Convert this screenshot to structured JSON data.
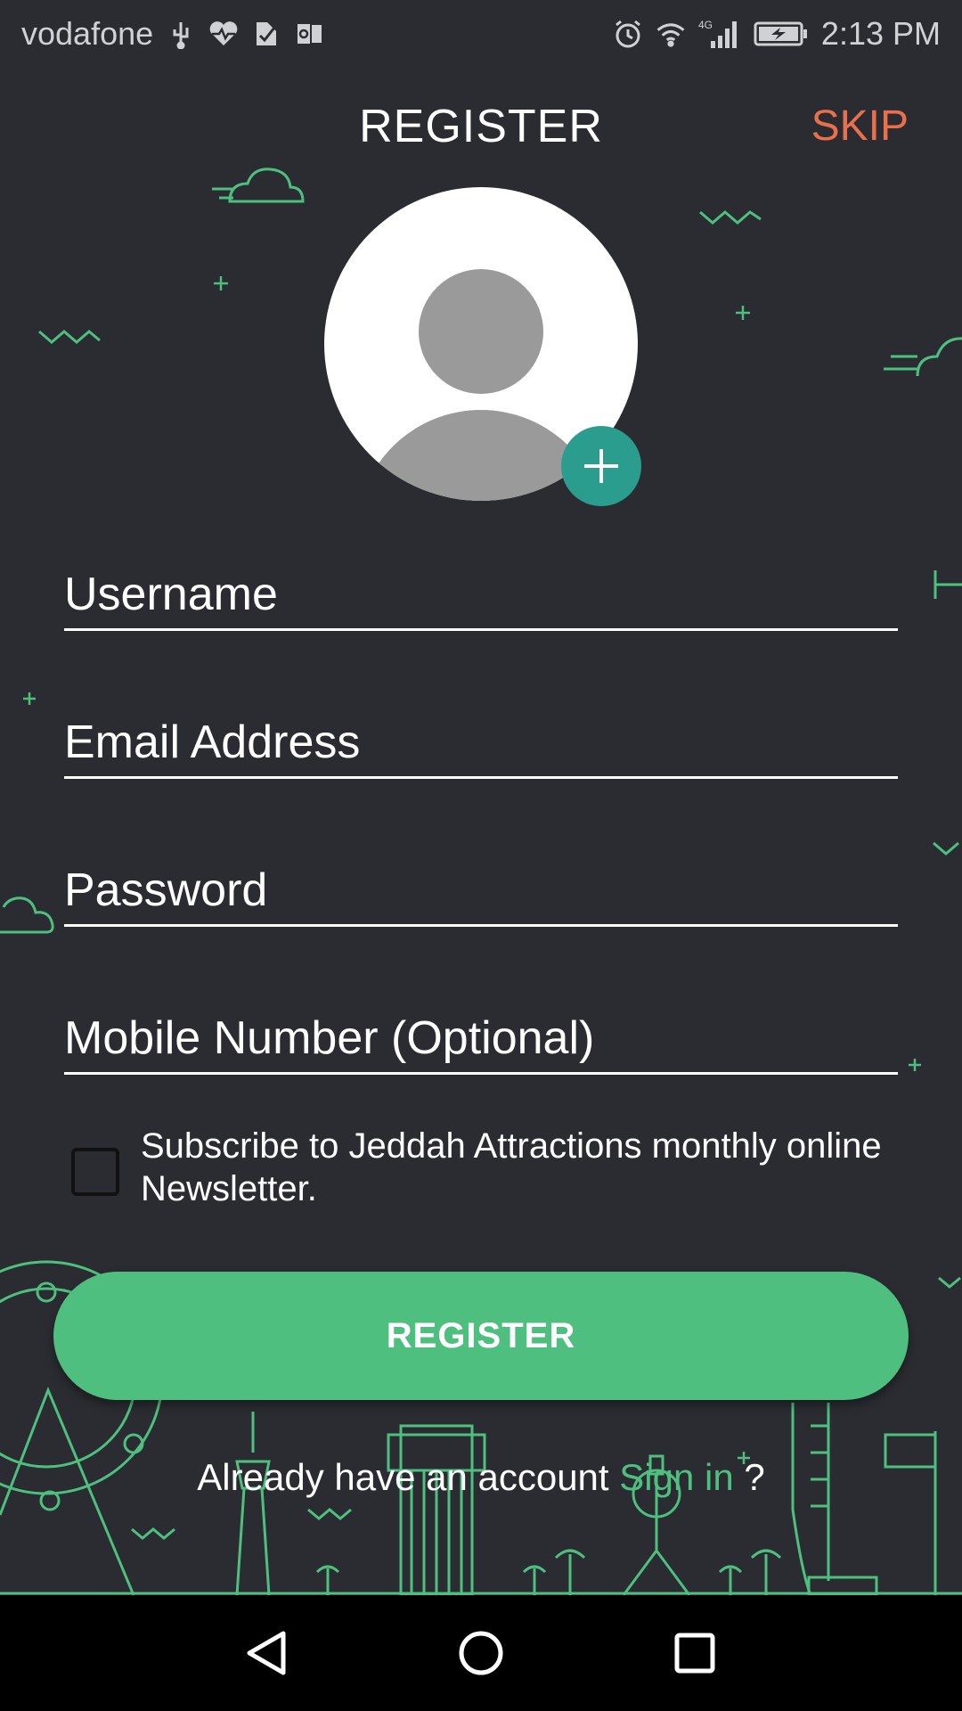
{
  "status_bar": {
    "carrier": "vodafone",
    "left_icons": [
      "usb-icon",
      "health-icon",
      "check-icon",
      "outlook-icon"
    ],
    "right_icons": [
      "alarm-icon",
      "wifi-icon",
      "signal-4g-icon",
      "battery-charging-icon"
    ],
    "network": "4G",
    "time": "2:13 PM"
  },
  "header": {
    "title": "REGISTER",
    "skip_label": "SKIP"
  },
  "avatar": {
    "icon": "user-avatar-icon",
    "add_icon": "plus-icon"
  },
  "form": {
    "username_placeholder": "Username",
    "email_placeholder": "Email Address",
    "password_placeholder": "Password",
    "mobile_placeholder": "Mobile Number (Optional)",
    "newsletter_label": "Subscribe to Jeddah Attractions monthly online Newsletter.",
    "newsletter_checked": false,
    "register_label": "REGISTER"
  },
  "signin": {
    "prefix": "Already have an account ",
    "link": "Sign in",
    "suffix": " ?"
  },
  "colors": {
    "background": "#2a2c31",
    "accent_green": "#4fbf7f",
    "skip_orange": "#e8704d",
    "add_teal": "#2a9d8f",
    "line_art": "#4fbf7f"
  },
  "nav_bar": {
    "icons": [
      "back-icon",
      "home-icon",
      "recents-icon"
    ]
  }
}
